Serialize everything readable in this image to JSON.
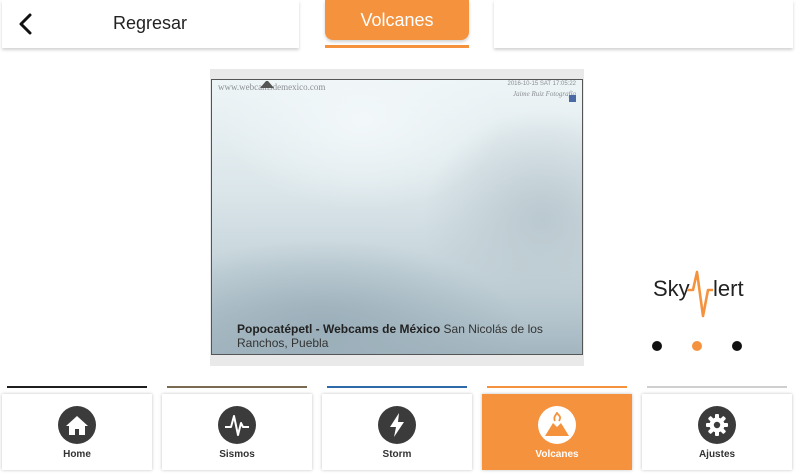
{
  "header": {
    "back_label": "Regresar",
    "active_tab_label": "Volcanes"
  },
  "webcam": {
    "site_url": "www.webcamsdemexico.com",
    "timestamp": "2016-10-15 SAT 17:05:22",
    "signature": "Jaime Ruiz Fotografía",
    "caption_title": "Popocatépetl - Webcams de México",
    "caption_location": "San Nicolás de los Ranchos, Puebla"
  },
  "brand": {
    "logo_text": "SkyAlert",
    "accent_color": "#f5923e"
  },
  "pagination": {
    "total": 3,
    "active_index": 1
  },
  "bottom_nav": {
    "items": [
      {
        "label": "Home",
        "icon": "home-icon",
        "active": false
      },
      {
        "label": "Sismos",
        "icon": "seismic-icon",
        "active": false
      },
      {
        "label": "Storm",
        "icon": "lightning-icon",
        "active": false
      },
      {
        "label": "Volcanes",
        "icon": "volcano-icon",
        "active": true
      },
      {
        "label": "Ajustes",
        "icon": "gear-icon",
        "active": false
      }
    ],
    "strip_colors": [
      "#1f1f1f",
      "#7a6a4f",
      "#2f6aa8",
      "#f5923e",
      "#cfcfcf"
    ]
  }
}
